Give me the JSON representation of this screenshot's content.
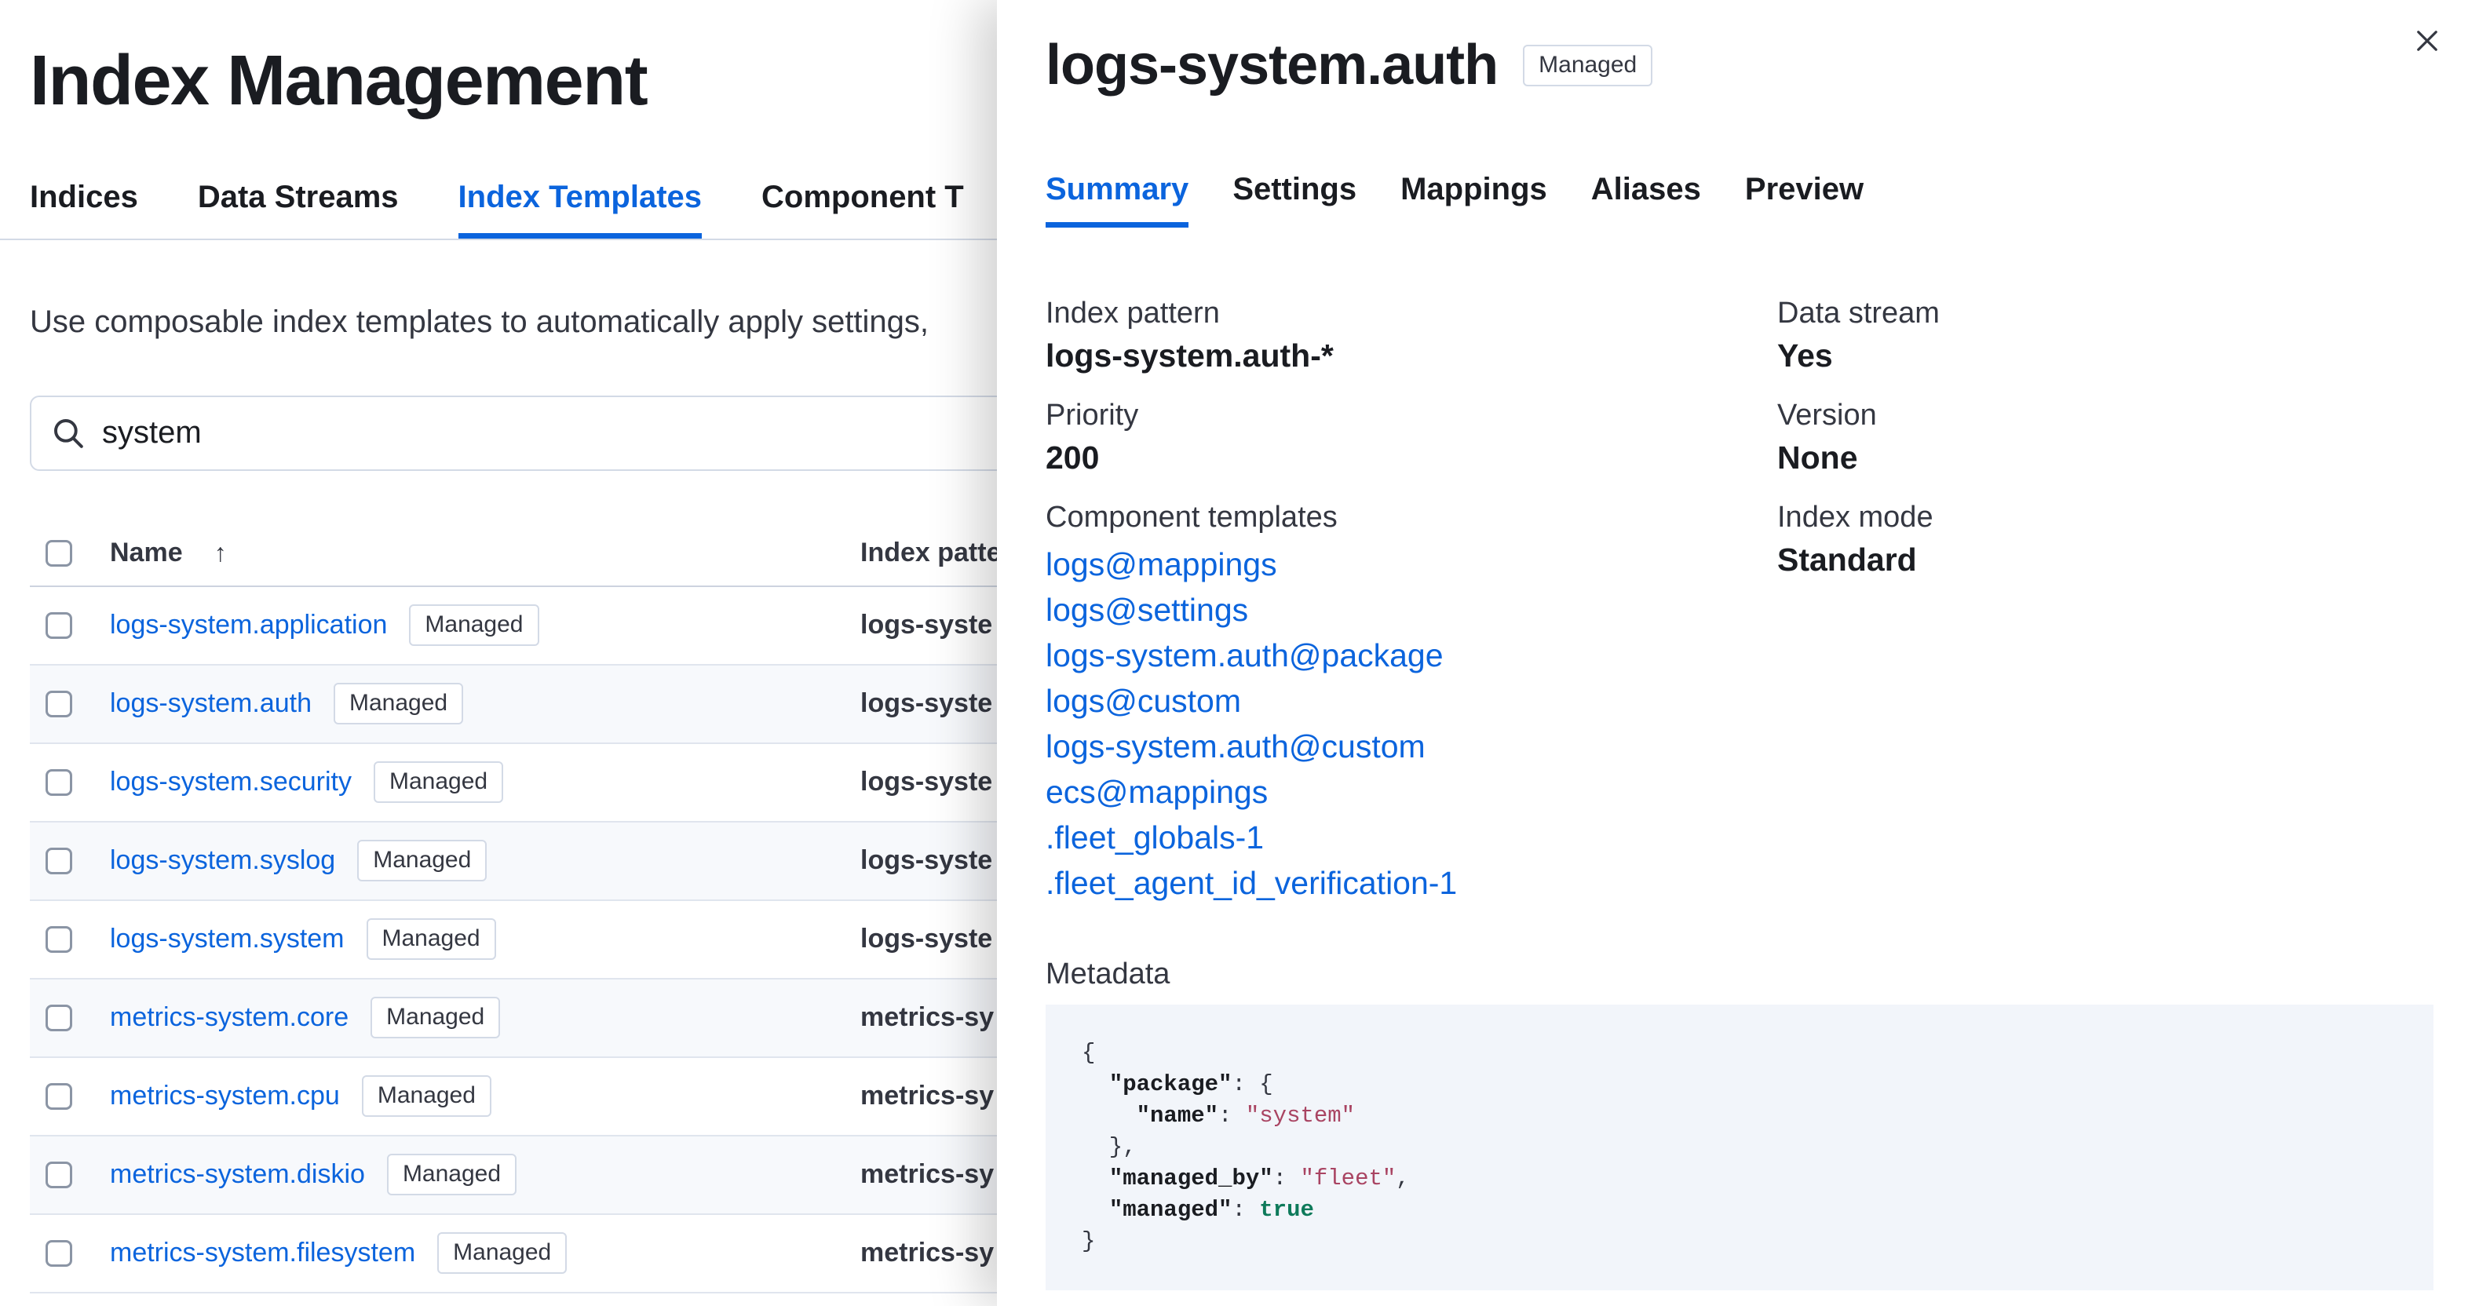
{
  "colors": {
    "accent_blue": "#0b64dd",
    "text": "#1a1c21",
    "subdued_text": "#343741",
    "border": "#d3dae6",
    "code_background": "#f2f5fa",
    "code_string": "#a94462",
    "code_boolean": "#0e7a5a"
  },
  "page": {
    "title": "Index Management",
    "tabs": [
      {
        "label": "Indices",
        "active": false
      },
      {
        "label": "Data Streams",
        "active": false
      },
      {
        "label": "Index Templates",
        "active": true
      },
      {
        "label": "Component T",
        "active": false
      }
    ],
    "description": "Use composable index templates to automatically apply settings,",
    "search": {
      "value": "system",
      "icon": "search-icon"
    },
    "table": {
      "columns": [
        {
          "label": "Name",
          "sort_icon": "sort-ascending-arrow"
        },
        {
          "label": "Index patter"
        }
      ],
      "rows": [
        {
          "name": "logs-system.application",
          "badge": "Managed",
          "index_pattern": "logs-syste"
        },
        {
          "name": "logs-system.auth",
          "badge": "Managed",
          "index_pattern": "logs-syste"
        },
        {
          "name": "logs-system.security",
          "badge": "Managed",
          "index_pattern": "logs-syste"
        },
        {
          "name": "logs-system.syslog",
          "badge": "Managed",
          "index_pattern": "logs-syste"
        },
        {
          "name": "logs-system.system",
          "badge": "Managed",
          "index_pattern": "logs-syste"
        },
        {
          "name": "metrics-system.core",
          "badge": "Managed",
          "index_pattern": "metrics-sy"
        },
        {
          "name": "metrics-system.cpu",
          "badge": "Managed",
          "index_pattern": "metrics-sy"
        },
        {
          "name": "metrics-system.diskio",
          "badge": "Managed",
          "index_pattern": "metrics-sy"
        },
        {
          "name": "metrics-system.filesystem",
          "badge": "Managed",
          "index_pattern": "metrics-sy"
        }
      ]
    }
  },
  "flyout": {
    "title": "logs-system.auth",
    "badge": "Managed",
    "close_icon": "close-icon",
    "tabs": [
      {
        "label": "Summary",
        "active": true
      },
      {
        "label": "Settings",
        "active": false
      },
      {
        "label": "Mappings",
        "active": false
      },
      {
        "label": "Aliases",
        "active": false
      },
      {
        "label": "Preview",
        "active": false
      }
    ],
    "summary": {
      "left": [
        {
          "label": "Index pattern",
          "value": "logs-system.auth-*"
        },
        {
          "label": "Priority",
          "value": "200"
        }
      ],
      "right": [
        {
          "label": "Data stream",
          "value": "Yes"
        },
        {
          "label": "Version",
          "value": "None"
        },
        {
          "label": "Index mode",
          "value": "Standard"
        }
      ],
      "component_templates": {
        "label": "Component templates",
        "links": [
          "logs@mappings",
          "logs@settings",
          "logs-system.auth@package",
          "logs@custom",
          "logs-system.auth@custom",
          "ecs@mappings",
          ".fleet_globals-1",
          ".fleet_agent_id_verification-1"
        ]
      },
      "metadata": {
        "label": "Metadata",
        "code_lines": [
          [
            {
              "t": "{",
              "c": "p"
            }
          ],
          [
            {
              "t": "  ",
              "c": "p"
            },
            {
              "t": "\"package\"",
              "c": "k"
            },
            {
              "t": ": {",
              "c": "p"
            }
          ],
          [
            {
              "t": "    ",
              "c": "p"
            },
            {
              "t": "\"name\"",
              "c": "k"
            },
            {
              "t": ": ",
              "c": "p"
            },
            {
              "t": "\"system\"",
              "c": "s"
            }
          ],
          [
            {
              "t": "  },",
              "c": "p"
            }
          ],
          [
            {
              "t": "  ",
              "c": "p"
            },
            {
              "t": "\"managed_by\"",
              "c": "k"
            },
            {
              "t": ": ",
              "c": "p"
            },
            {
              "t": "\"fleet\"",
              "c": "s"
            },
            {
              "t": ",",
              "c": "p"
            }
          ],
          [
            {
              "t": "  ",
              "c": "p"
            },
            {
              "t": "\"managed\"",
              "c": "k"
            },
            {
              "t": ": ",
              "c": "p"
            },
            {
              "t": "true",
              "c": "b"
            }
          ],
          [
            {
              "t": "}",
              "c": "p"
            }
          ]
        ]
      }
    }
  }
}
